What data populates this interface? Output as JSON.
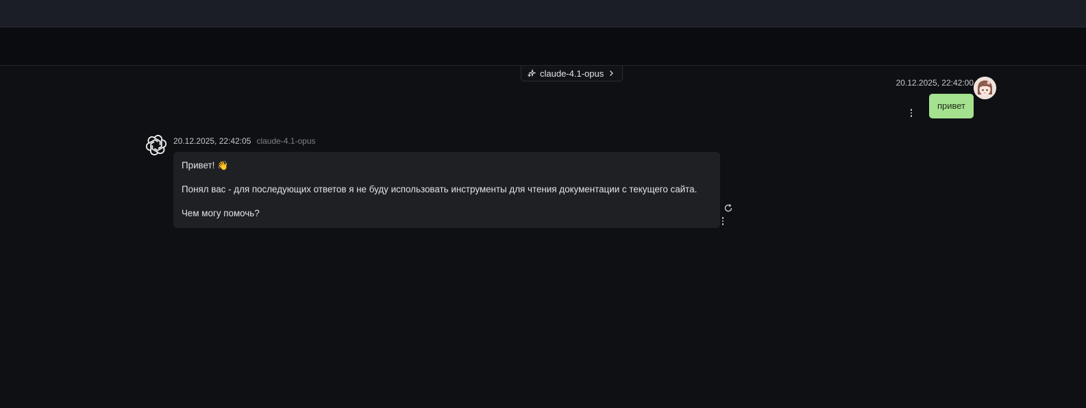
{
  "header": {
    "model_selector": {
      "label": "claude-4.1-opus",
      "icon": "sparkle-icon",
      "chevron": "chevron-right-icon"
    }
  },
  "messages": [
    {
      "role": "user",
      "timestamp": "20.12.2025, 22:42:00",
      "text": "привет",
      "bubble_color": "#a5e28f",
      "avatar": "user-avatar"
    },
    {
      "role": "assistant",
      "timestamp": "20.12.2025, 22:42:05",
      "model": "claude-4.1-opus",
      "avatar": "openai-logo-icon",
      "greeting": "Привет!",
      "greeting_emoji": "👋",
      "paragraph_2": "Понял вас - для последующих ответов я не буду использовать инструменты для чтения документации с текущего сайта.",
      "paragraph_3": "Чем могу помочь?",
      "bubble_color": "#1f2023"
    }
  ],
  "colors": {
    "background": "#0f1014",
    "topbar": "#1b1e27",
    "subbar": "#0b0c0f"
  }
}
